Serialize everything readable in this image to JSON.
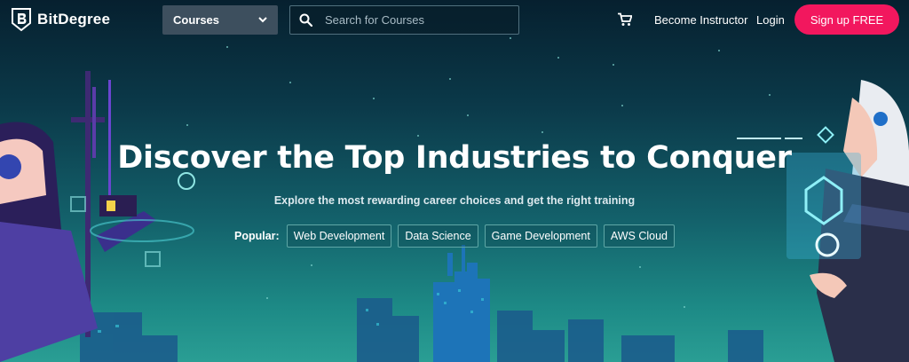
{
  "brand": {
    "name": "BitDegree",
    "logo_icon": "bitdegree-shield-logo"
  },
  "header": {
    "courses_label": "Courses",
    "search_placeholder": "Search for Courses",
    "cart_icon": "cart-icon",
    "become_instructor": "Become Instructor",
    "login": "Login",
    "signup": "Sign up FREE"
  },
  "hero": {
    "title": "Discover the Top Industries to Conquer",
    "subtitle": "Explore the most rewarding career choices and get the right training",
    "popular_label": "Popular:",
    "chips": [
      "Web Development",
      "Data Science",
      "Game Development",
      "AWS Cloud"
    ]
  },
  "colors": {
    "signup_bg": "#f2175e",
    "courses_bg": "#3d4f5e",
    "bg_top": "#06202f",
    "bg_bottom": "#2a9e94"
  }
}
